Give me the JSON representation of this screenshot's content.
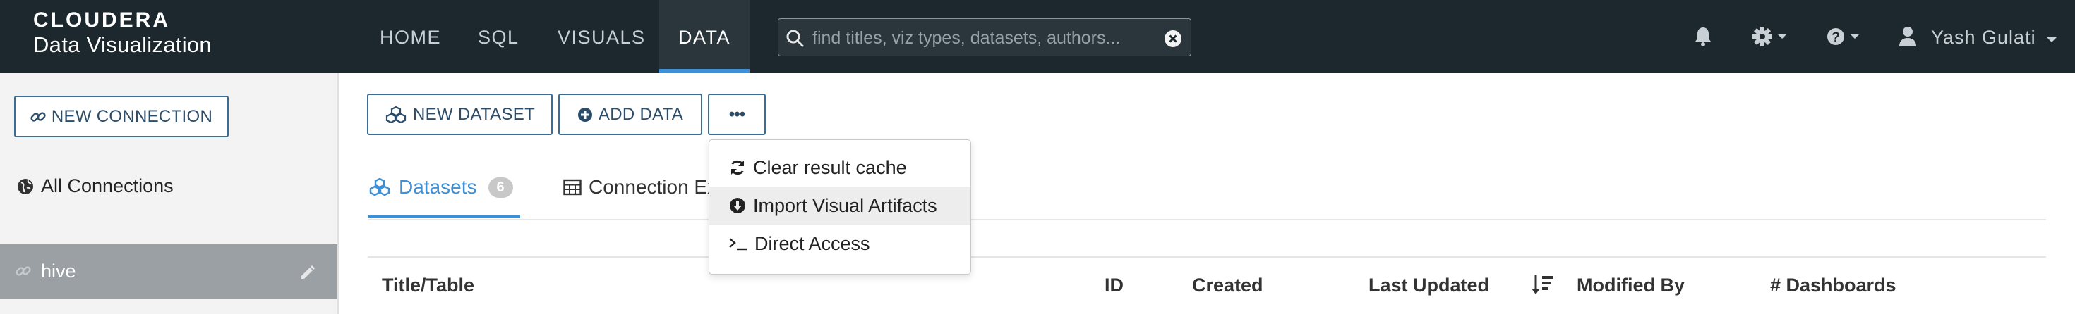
{
  "app": {
    "brand": "CLOUDERA",
    "product": "Data Visualization"
  },
  "nav": {
    "items": [
      "HOME",
      "SQL",
      "VISUALS",
      "DATA"
    ],
    "active": "DATA"
  },
  "search": {
    "placeholder": "find titles, viz types, datasets, authors...",
    "value": ""
  },
  "user": {
    "name": "Yash Gulati"
  },
  "sidebar": {
    "new_connection_label": "NEW CONNECTION",
    "all_connections_label": "All Connections",
    "connections": [
      {
        "label": "hive",
        "selected": true
      }
    ]
  },
  "toolbar": {
    "new_dataset_label": "NEW DATASET",
    "add_data_label": "ADD DATA",
    "more_label": "•••"
  },
  "tabs": [
    {
      "label": "Datasets",
      "count": "6",
      "active": true
    },
    {
      "label": "Connection Ex",
      "active": false
    }
  ],
  "dropdown": {
    "items": [
      {
        "label": "Clear result cache",
        "icon": "refresh-icon"
      },
      {
        "label": "Import Visual Artifacts",
        "icon": "download-circle-icon",
        "highlighted": true
      },
      {
        "label": "Direct Access",
        "icon": "terminal-icon"
      }
    ]
  },
  "table": {
    "columns": [
      "Title/Table",
      "ID",
      "Created",
      "Last Updated",
      "Modified By",
      "# Dashboards"
    ]
  },
  "colors": {
    "header_bg": "#1c272e",
    "accent": "#3d8fd6",
    "button_border": "#3a6d98",
    "selected_row": "#9aa0a4"
  }
}
